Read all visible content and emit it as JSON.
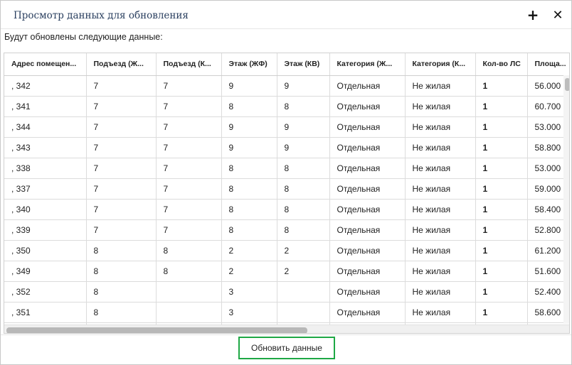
{
  "dialog": {
    "title": "Просмотр данных для обновления",
    "add_icon": "plus-icon",
    "close_icon": "close-icon",
    "subtitle": "Будут обновлены следующие данные:"
  },
  "table": {
    "columns": [
      "Адрес помещен...",
      "Подъезд (Ж...",
      "Подъезд (К...",
      "Этаж (ЖФ)",
      "Этаж (КВ)",
      "Категория (Ж...",
      "Категория (К...",
      "Кол-во ЛС",
      "Площа..."
    ],
    "rows": [
      [
        ", 342",
        "7",
        "7",
        "9",
        "9",
        "Отдельная",
        "Не жилая",
        "1",
        "56.000"
      ],
      [
        ", 341",
        "7",
        "7",
        "8",
        "8",
        "Отдельная",
        "Не жилая",
        "1",
        "60.700"
      ],
      [
        ", 344",
        "7",
        "7",
        "9",
        "9",
        "Отдельная",
        "Не жилая",
        "1",
        "53.000"
      ],
      [
        ", 343",
        "7",
        "7",
        "9",
        "9",
        "Отдельная",
        "Не жилая",
        "1",
        "58.800"
      ],
      [
        ", 338",
        "7",
        "7",
        "8",
        "8",
        "Отдельная",
        "Не жилая",
        "1",
        "53.000"
      ],
      [
        ", 337",
        "7",
        "7",
        "8",
        "8",
        "Отдельная",
        "Не жилая",
        "1",
        "59.000"
      ],
      [
        ", 340",
        "7",
        "7",
        "8",
        "8",
        "Отдельная",
        "Не жилая",
        "1",
        "58.400"
      ],
      [
        ", 339",
        "7",
        "7",
        "8",
        "8",
        "Отдельная",
        "Не жилая",
        "1",
        "52.800"
      ],
      [
        ", 350",
        "8",
        "8",
        "2",
        "2",
        "Отдельная",
        "Не жилая",
        "1",
        "61.200"
      ],
      [
        ", 349",
        "8",
        "8",
        "2",
        "2",
        "Отдельная",
        "Не жилая",
        "1",
        "51.600"
      ],
      [
        ", 352",
        "8",
        "",
        "3",
        "",
        "Отдельная",
        "Не жилая",
        "1",
        "52.400"
      ],
      [
        ", 351",
        "8",
        "",
        "3",
        "",
        "Отдельная",
        "Не жилая",
        "1",
        "58.600"
      ],
      [
        "",
        "",
        "",
        "",
        "",
        "",
        "",
        "",
        ""
      ]
    ]
  },
  "footer": {
    "update_label": "Обновить данные",
    "accent_color": "#1ea845"
  }
}
